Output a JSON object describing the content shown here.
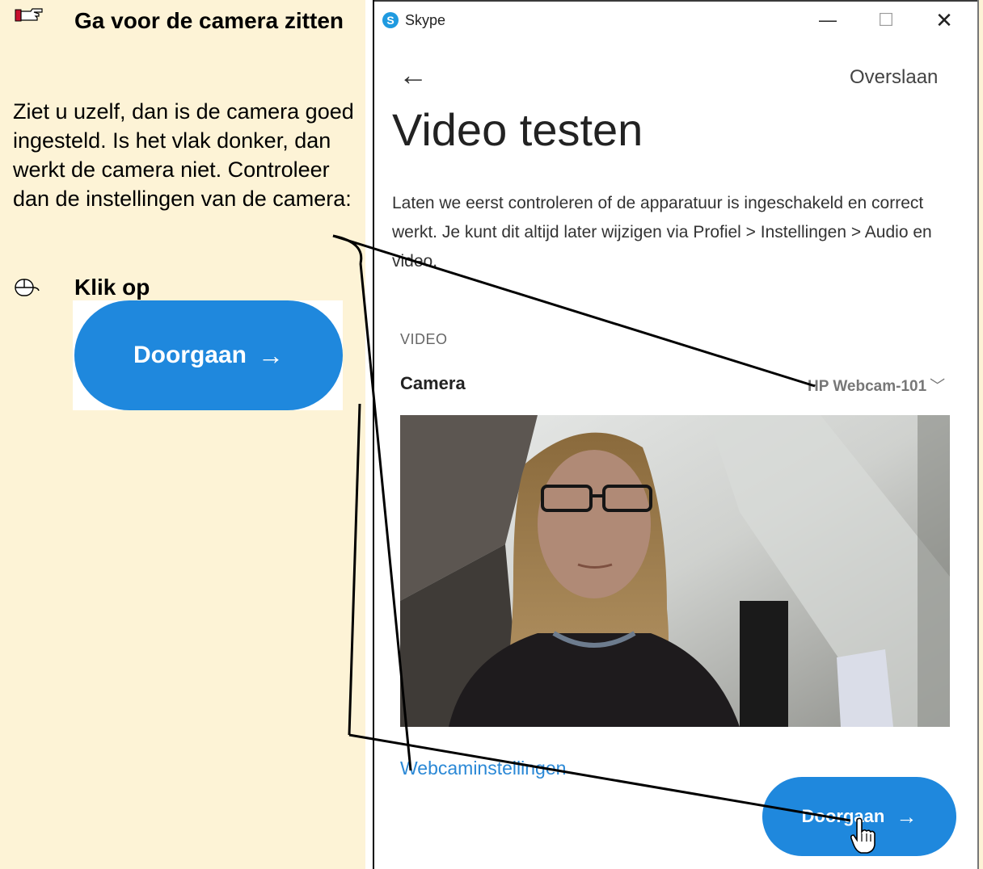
{
  "guide": {
    "step_title": "Ga voor de camera zitten",
    "paragraph": "Ziet u uzelf, dan is de camera goed ingesteld. Is het vlak donker, dan werkt de camera niet. Controleer dan de instellingen van de camera:",
    "click_label": "Klik op",
    "button_example_label": "Doorgaan",
    "button_example_arrow": "→"
  },
  "window": {
    "app_title": "Skype",
    "app_icon_letter": "S",
    "minimize": "—",
    "maximize": "☐",
    "close": "✕"
  },
  "page": {
    "back": "←",
    "skip": "Overslaan",
    "title": "Video testen",
    "description": "Laten we eerst controleren of de apparatuur is ingeschakeld en correct werkt. Je kunt dit altijd later wijzigen via Profiel > Instellingen > Audio en video.",
    "section_label": "VIDEO",
    "camera_label": "Camera",
    "camera_value": "HP Webcam-101",
    "camera_chevron": "﹀",
    "webcam_settings_link": "Webcaminstellingen",
    "continue_label": "Doorgaan",
    "continue_arrow": "→"
  },
  "colors": {
    "guide_background": "#fdf3d6",
    "accent_blue": "#1f88dd",
    "link_blue": "#2a88d6"
  }
}
